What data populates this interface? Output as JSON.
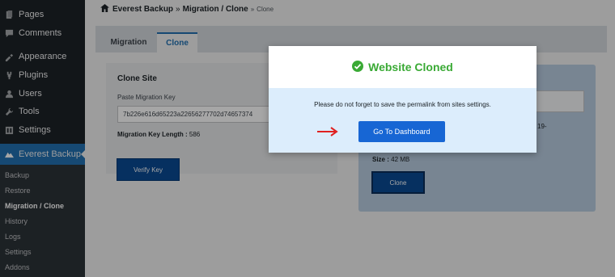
{
  "sidebar": {
    "items": [
      {
        "label": "Pages",
        "icon": "pages-icon"
      },
      {
        "label": "Comments",
        "icon": "comments-icon"
      },
      {
        "label": "Appearance",
        "icon": "appearance-icon"
      },
      {
        "label": "Plugins",
        "icon": "plugins-icon"
      },
      {
        "label": "Users",
        "icon": "users-icon"
      },
      {
        "label": "Tools",
        "icon": "tools-icon"
      },
      {
        "label": "Settings",
        "icon": "settings-icon"
      }
    ],
    "active": {
      "label": "Everest Backup",
      "icon": "everest-backup-icon"
    },
    "submenu": [
      "Backup",
      "Restore",
      "Migration / Clone",
      "History",
      "Logs",
      "Settings",
      "Addons"
    ]
  },
  "breadcrumb": {
    "root": "Everest Backup",
    "sep1": "»",
    "section": "Migration / Clone",
    "sep2": "»",
    "current": "Clone"
  },
  "tabs": {
    "migration": "Migration",
    "clone": "Clone"
  },
  "clone_site": {
    "title": "Clone Site",
    "key_label": "Paste Migration Key",
    "key_value": "7b226e616d65223a22656277702d74657374",
    "length_label": "Migration Key Length :",
    "length_value": "586",
    "verify_button": "Verify Key"
  },
  "right_card": {
    "fragment": "19-",
    "size_label": "Size :",
    "size_value": "42 MB",
    "clone_button": "Clone"
  },
  "modal": {
    "title": "Website Cloned",
    "message": "Please do not forget to save the permalink from sites settings.",
    "dashboard_button": "Go To Dashboard"
  },
  "colors": {
    "sidebar_bg": "#1d2327",
    "accent": "#2271b1",
    "success": "#3aaa35",
    "button_blue": "#1766d4",
    "arrow_red": "#e02020"
  }
}
